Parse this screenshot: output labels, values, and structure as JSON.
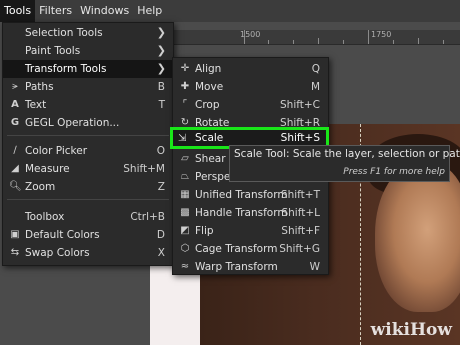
{
  "menubar": {
    "items": [
      {
        "label": "Tools",
        "active": true
      },
      {
        "label": "Filters"
      },
      {
        "label": "Windows"
      },
      {
        "label": "Help"
      }
    ]
  },
  "ruler": {
    "labels": [
      "1500",
      "1750"
    ]
  },
  "tools_menu": {
    "items": [
      {
        "label": "Selection Tools",
        "submenu": true
      },
      {
        "label": "Paint Tools",
        "submenu": true
      },
      {
        "label": "Transform Tools",
        "submenu": true,
        "highlighted": true
      },
      {
        "label": "Paths",
        "shortcut": "B",
        "icon": "paths-icon"
      },
      {
        "label": "Text",
        "shortcut": "T",
        "icon": "text-icon"
      },
      {
        "label": "GEGL Operation...",
        "icon": "gegl-icon"
      },
      {
        "label": "Color Picker",
        "shortcut": "O",
        "icon": "color-picker-icon"
      },
      {
        "label": "Measure",
        "shortcut": "Shift+M",
        "icon": "measure-icon"
      },
      {
        "label": "Zoom",
        "shortcut": "Z",
        "icon": "zoom-icon"
      },
      {
        "label": "Toolbox",
        "shortcut": "Ctrl+B"
      },
      {
        "label": "Default Colors",
        "shortcut": "D",
        "icon": "default-colors-icon"
      },
      {
        "label": "Swap Colors",
        "shortcut": "X",
        "icon": "swap-colors-icon"
      }
    ]
  },
  "transform_menu": {
    "items": [
      {
        "label": "Align",
        "shortcut": "Q",
        "icon": "align-icon"
      },
      {
        "label": "Move",
        "shortcut": "M",
        "icon": "move-icon"
      },
      {
        "label": "Crop",
        "shortcut": "Shift+C",
        "icon": "crop-icon"
      },
      {
        "label": "Rotate",
        "shortcut": "Shift+R",
        "icon": "rotate-icon"
      },
      {
        "label": "Scale",
        "shortcut": "Shift+S",
        "icon": "scale-icon",
        "highlighted": true
      },
      {
        "label": "Shear",
        "icon": "shear-icon"
      },
      {
        "label": "Perspecti",
        "icon": "perspective-icon"
      },
      {
        "label": "Unified Transform",
        "shortcut": "Shift+T",
        "icon": "unified-transform-icon"
      },
      {
        "label": "Handle Transform",
        "shortcut": "Shift+L",
        "icon": "handle-transform-icon"
      },
      {
        "label": "Flip",
        "shortcut": "Shift+F",
        "icon": "flip-icon"
      },
      {
        "label": "Cage Transform",
        "shortcut": "Shift+G",
        "icon": "cage-transform-icon"
      },
      {
        "label": "Warp Transform",
        "shortcut": "W",
        "icon": "warp-transform-icon"
      }
    ]
  },
  "tooltip": {
    "text": "Scale Tool: Scale the layer, selection or path",
    "help": "Press F1 for more help"
  },
  "watermark": {
    "text": "wiki",
    "bold": "How"
  },
  "colors": {
    "highlight_border": "#19e619",
    "menu_bg": "#2b2b2b",
    "selected_bg": "#151515"
  }
}
